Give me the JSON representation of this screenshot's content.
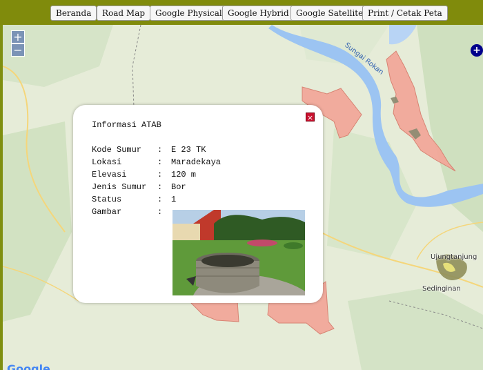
{
  "toolbar": {
    "buttons": [
      "Beranda",
      "Road Map",
      "Google Physical",
      "Google Hybrid",
      "Google Satellite",
      "Print / Cetak Peta"
    ]
  },
  "map": {
    "zoom_in": "+",
    "zoom_out": "−",
    "layer_switcher": "+",
    "labels": {
      "river": "Sungai Rokan",
      "town1": "Ujungtanjung",
      "town2": "Sedinginan"
    },
    "attribution": "Google"
  },
  "popup": {
    "title": "Informasi ATAB",
    "close": "×",
    "rows": [
      {
        "key": "Kode Sumur",
        "sep": ":",
        "value": "E 23 TK"
      },
      {
        "key": "Lokasi",
        "sep": ":",
        "value": "Maradekaya"
      },
      {
        "key": "Elevasi",
        "sep": ":",
        "value": "120 m"
      },
      {
        "key": "Jenis Sumur",
        "sep": ":",
        "value": "Bor"
      },
      {
        "key": "Status",
        "sep": ":",
        "value": "1"
      },
      {
        "key": "Gambar",
        "sep": ":",
        "value": ""
      }
    ]
  },
  "colors": {
    "topbar": "#808b0c",
    "polygon_fill": "#f2a89a",
    "polygon_stroke": "#d77e6e",
    "river": "#9cc4f2",
    "close_button": "#c8102e"
  }
}
